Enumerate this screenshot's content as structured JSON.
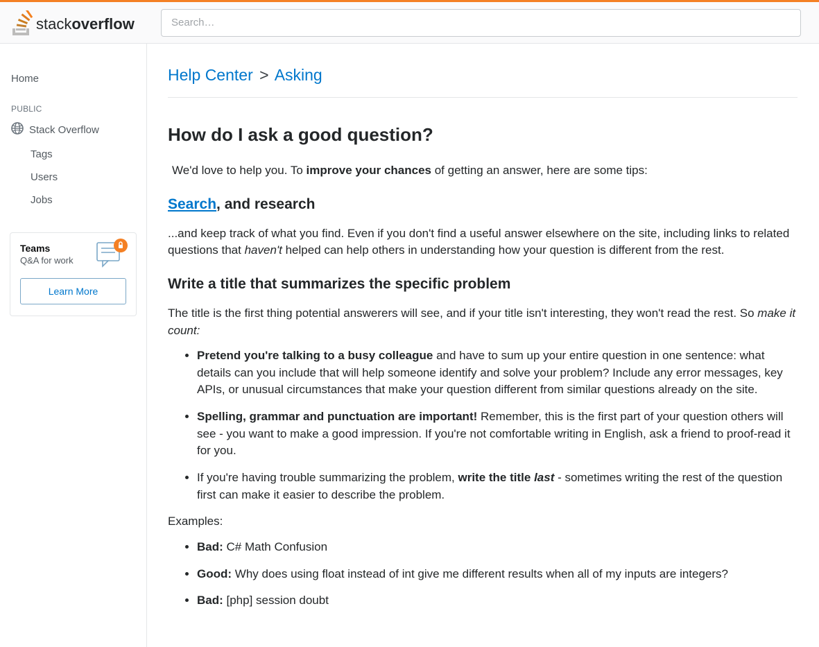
{
  "header": {
    "search_placeholder": "Search…"
  },
  "sidebar": {
    "home": "Home",
    "public_label": "PUBLIC",
    "items": [
      {
        "label": "Stack Overflow",
        "icon": "globe"
      },
      {
        "label": "Tags"
      },
      {
        "label": "Users"
      },
      {
        "label": "Jobs"
      }
    ],
    "teams": {
      "title": "Teams",
      "subtitle": "Q&A for work",
      "learn_more": "Learn More"
    }
  },
  "breadcrumb": {
    "help_center": "Help Center",
    "separator": ">",
    "asking": "Asking"
  },
  "article": {
    "title": "How do I ask a good question?",
    "intro_before": "We'd love to help you. To ",
    "intro_bold": "improve your chances",
    "intro_after": " of getting an answer, here are some tips:",
    "section_search": {
      "link": "Search",
      "after_link": ", and research",
      "para_before_italic": "...and keep track of what you find. Even if you don't find a useful answer elsewhere on the site, including links to related questions that ",
      "italic": "haven't",
      "para_after_italic": " helped can help others in understanding how your question is different from the rest."
    },
    "section_title_heading": "Write a title that summarizes the specific problem",
    "title_para_before_italic": "The title is the first thing potential answerers will see, and if your title isn't interesting, they won't read the rest. So ",
    "title_para_italic": "make it count:",
    "tips": [
      {
        "bold": "Pretend you're talking to a busy colleague",
        "rest": " and have to sum up your entire question in one sentence: what details can you include that will help someone identify and solve your problem? Include any error messages, key APIs, or unusual circumstances that make your question different from similar questions already on the site."
      },
      {
        "bold": "Spelling, grammar and punctuation are important!",
        "rest": " Remember, this is the first part of your question others will see - you want to make a good impression. If you're not comfortable writing in English, ask a friend to proof-read it for you."
      },
      {
        "prefix": "If you're having trouble summarizing the problem, ",
        "bold": "write the title ",
        "bold_italic": "last",
        "rest": " - sometimes writing the rest of the question first can make it easier to describe the problem."
      }
    ],
    "examples_label": "Examples:",
    "examples": [
      {
        "label": "Bad:",
        "text": " C# Math Confusion"
      },
      {
        "label": "Good:",
        "text": " Why does using float instead of int give me different results when all of my inputs are integers?"
      },
      {
        "label": "Bad:",
        "text": " [php] session doubt"
      }
    ]
  }
}
